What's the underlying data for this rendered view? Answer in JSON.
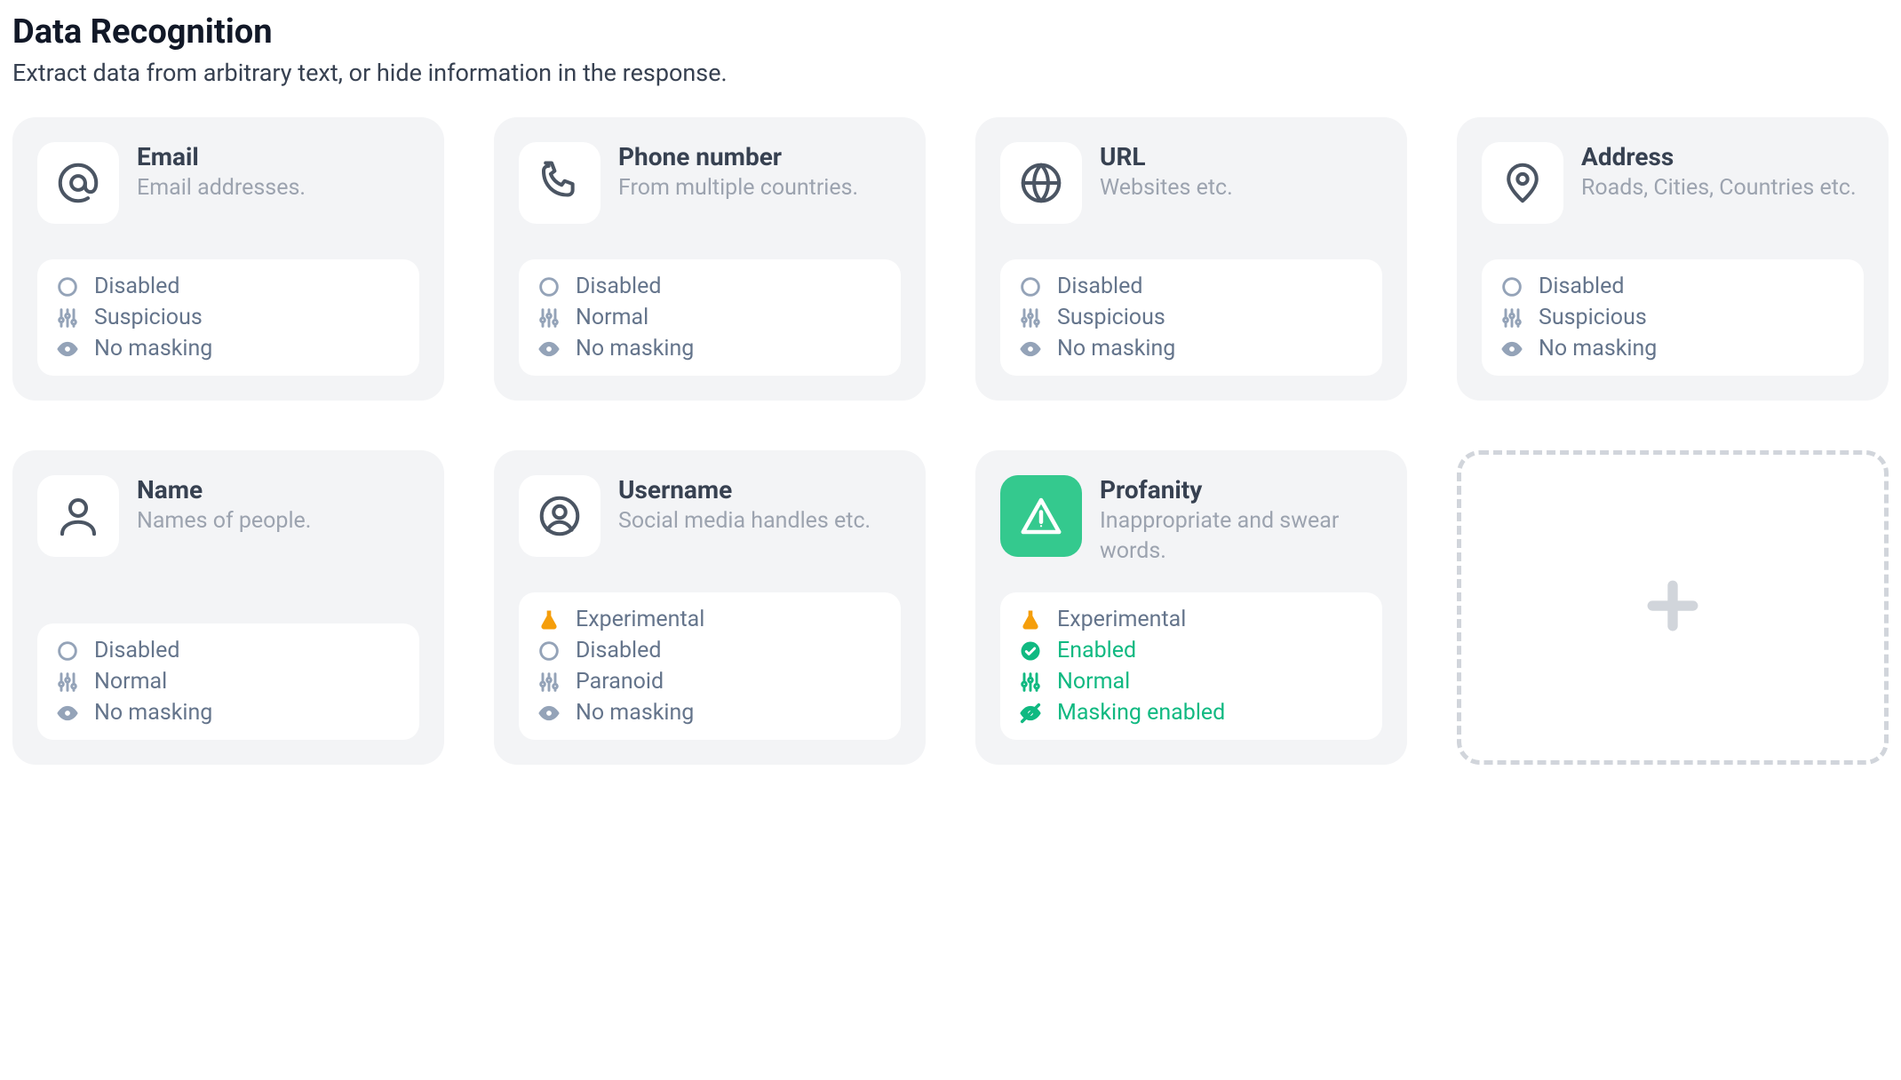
{
  "page": {
    "title": "Data Recognition",
    "subtitle": "Extract data from arbitrary text, or hide information in the response."
  },
  "status_labels": {
    "experimental": "Experimental",
    "disabled": "Disabled",
    "enabled": "Enabled",
    "suspicious": "Suspicious",
    "normal": "Normal",
    "paranoid": "Paranoid",
    "no_masking": "No masking",
    "masking_enabled": "Masking enabled"
  },
  "cards": {
    "email": {
      "title": "Email",
      "desc": "Email addresses."
    },
    "phone": {
      "title": "Phone number",
      "desc": "From multiple countries."
    },
    "url": {
      "title": "URL",
      "desc": "Websites etc."
    },
    "address": {
      "title": "Address",
      "desc": "Roads, Cities, Countries etc."
    },
    "name": {
      "title": "Name",
      "desc": "Names of people."
    },
    "username": {
      "title": "Username",
      "desc": "Social media handles etc."
    },
    "profanity": {
      "title": "Profanity",
      "desc": "Inappropriate and swear words."
    }
  }
}
